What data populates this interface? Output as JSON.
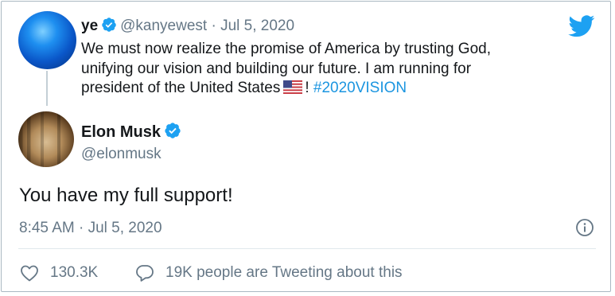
{
  "quoted_tweet": {
    "name": "ye",
    "handle": "@kanyewest",
    "separator": "·",
    "date": "Jul 5, 2020",
    "text_before_flag": "We must now realize the promise of America by trusting God, unifying our vision and building our future. I am running for president of the United States",
    "text_after_flag": "!",
    "hashtag": "#2020VISION"
  },
  "tweet": {
    "name": "Elon Musk",
    "handle": "@elonmusk",
    "text": "You have my full support!",
    "timestamp": "8:45 AM · Jul 5, 2020"
  },
  "actions": {
    "likes": "130.3K",
    "reply_text": "19K people are Tweeting about this"
  },
  "icons": {
    "bird": "twitter-bird-icon",
    "verified": "verified-badge-icon",
    "info": "info-icon",
    "like": "heart-icon",
    "reply": "speech-bubble-icon",
    "flag": "us-flag-emoji"
  },
  "colors": {
    "brand": "#1da1f2",
    "hashtag": "#1b95e0",
    "muted": "#657786",
    "text": "#14171a",
    "border": "#aab8c2"
  }
}
